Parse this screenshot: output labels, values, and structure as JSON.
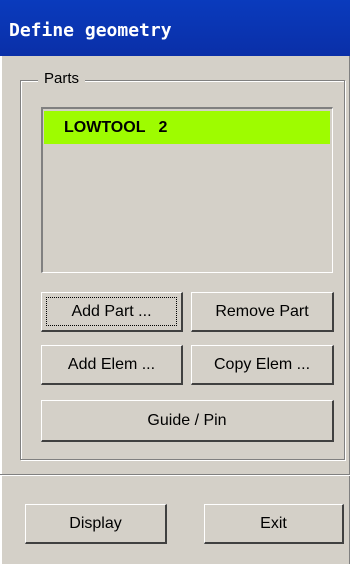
{
  "window": {
    "title": "Define geometry"
  },
  "parts_group": {
    "legend": "Parts",
    "items": [
      {
        "label": "LOWTOOL   2"
      }
    ]
  },
  "buttons": {
    "add_part": "Add Part ...",
    "remove_part": "Remove Part",
    "add_elem": "Add Elem ...",
    "copy_elem": "Copy Elem ...",
    "guide_pin": "Guide / Pin",
    "display": "Display",
    "exit": "Exit"
  },
  "colors": {
    "selection": "#9efc00",
    "titlebar": "#0a3bbd"
  }
}
